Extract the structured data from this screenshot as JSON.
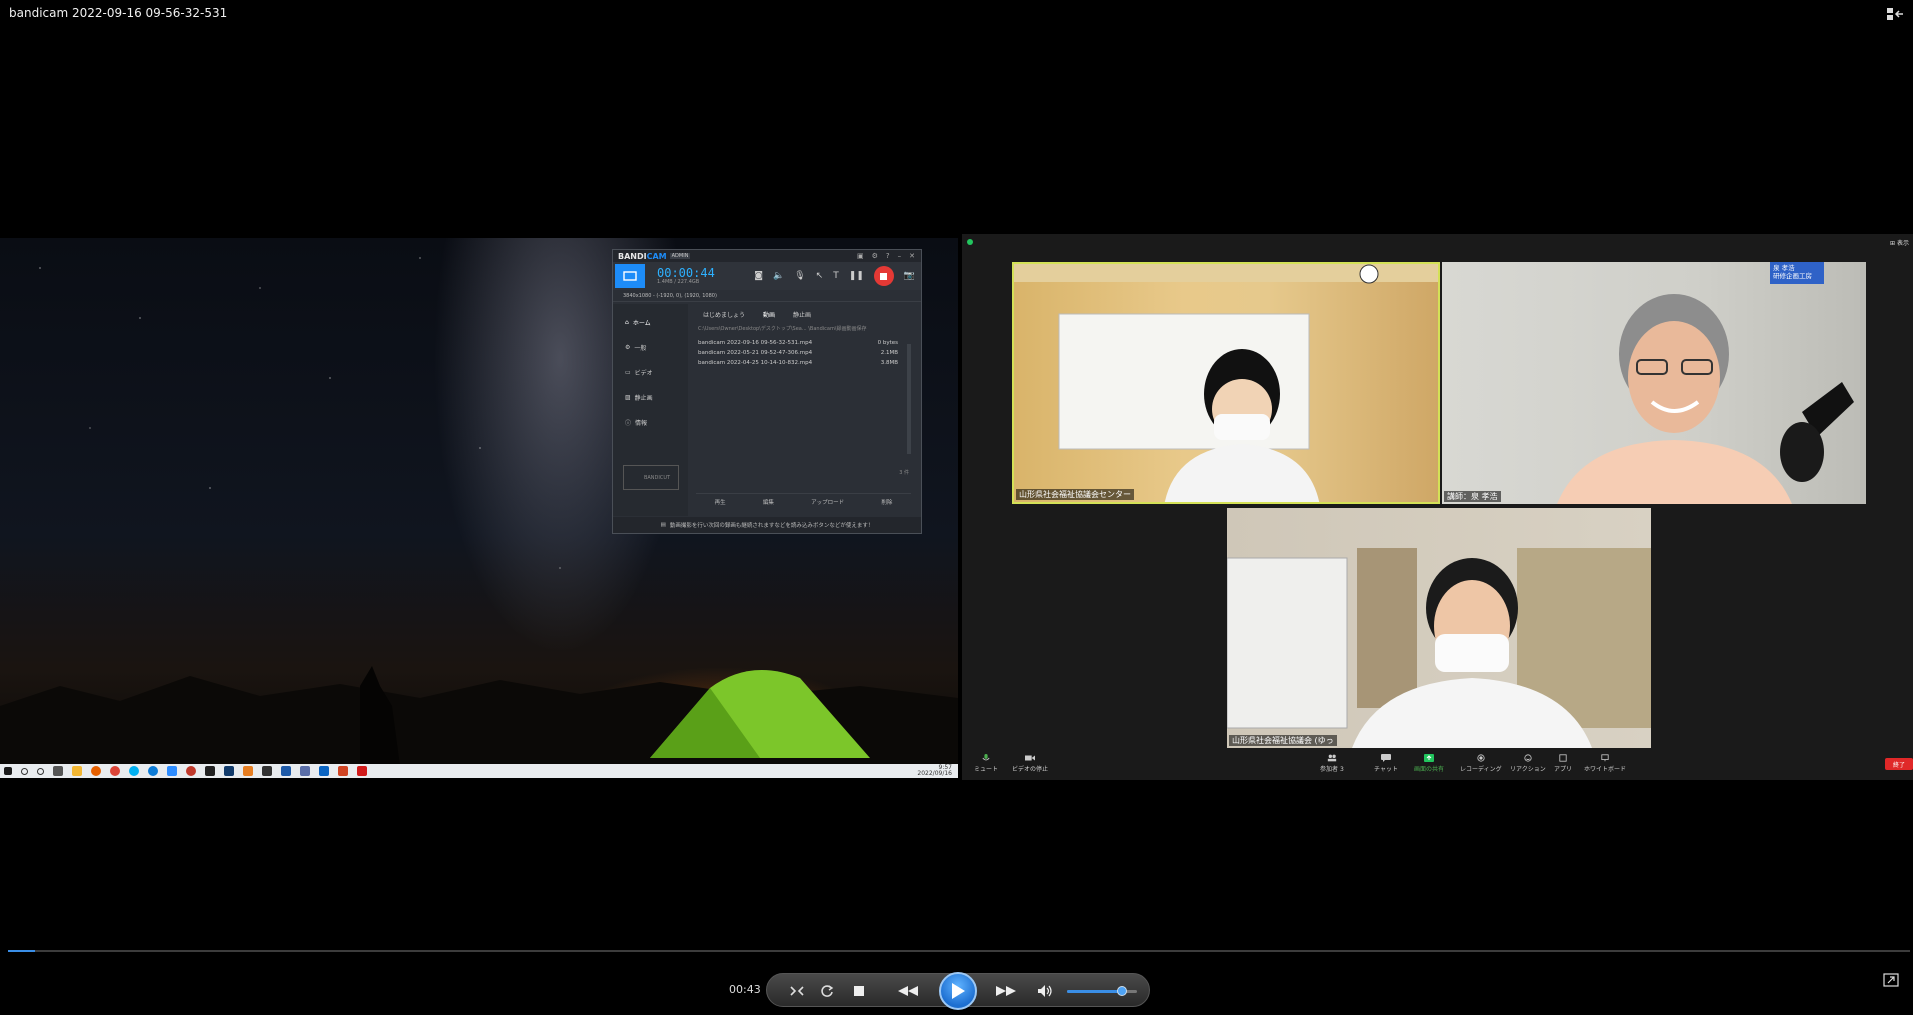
{
  "window": {
    "title": "bandicam 2022-09-16 09-56-32-531"
  },
  "bandicam": {
    "logo_a": "BANDI",
    "logo_b": "CAM",
    "badge": "ADMIN",
    "timer": "00:00:44",
    "timer_sub": "1.4MB / 227.4GB",
    "resolution": "3840x1080 - (-1920, 0), (1920, 1080)",
    "sidebar": [
      "ホーム",
      "一般",
      "ビデオ",
      "静止画",
      "情報"
    ],
    "tabs": [
      "はじめましょう",
      "動画",
      "静止画"
    ],
    "path": "C:\\Users\\Owner\\Desktop\\デスクトップ\\Sea... \\Bandicam\\録画動画保存",
    "files": [
      {
        "name": "bandicam 2022-09-16 09-56-32-531.mp4",
        "size": "0 bytes"
      },
      {
        "name": "bandicam 2022-05-21 09-52-47-306.mp4",
        "size": "2.1MB"
      },
      {
        "name": "bandicam 2022-04-25 10-14-10-832.mp4",
        "size": "3.8MB"
      }
    ],
    "count": "3 件",
    "bandicut": "BANDICUT",
    "actions": [
      "再生",
      "編集",
      "アップロード",
      "削除"
    ],
    "footer": "動画撮影を行い次回の録画も継続されますなどを読み込みボタンなどが使えます！"
  },
  "taskbar": {
    "clock_time": "9:57",
    "clock_date": "2022/09/16"
  },
  "zoom": {
    "view_label": "表示",
    "tiles": [
      {
        "name": "山形県社会福祉協議会センター"
      },
      {
        "name": "講師：泉 孝浩",
        "badge": "泉 孝浩\n研修企画工房"
      },
      {
        "name": "山形県社会福祉協議会 (ゆっ"
      }
    ],
    "toolbar": {
      "mute": "ミュート",
      "video": "ビデオの停止",
      "participants": "参加者",
      "participants_count": "3",
      "chat": "チャット",
      "share": "画面の共有",
      "record": "レコーディング",
      "reactions": "リアクション",
      "apps": "アプリ",
      "whiteboard": "ホワイトボード",
      "end": "終了"
    }
  },
  "player": {
    "current_time": "00:43",
    "progress_fraction": 0.014,
    "volume_fraction": 0.78
  }
}
